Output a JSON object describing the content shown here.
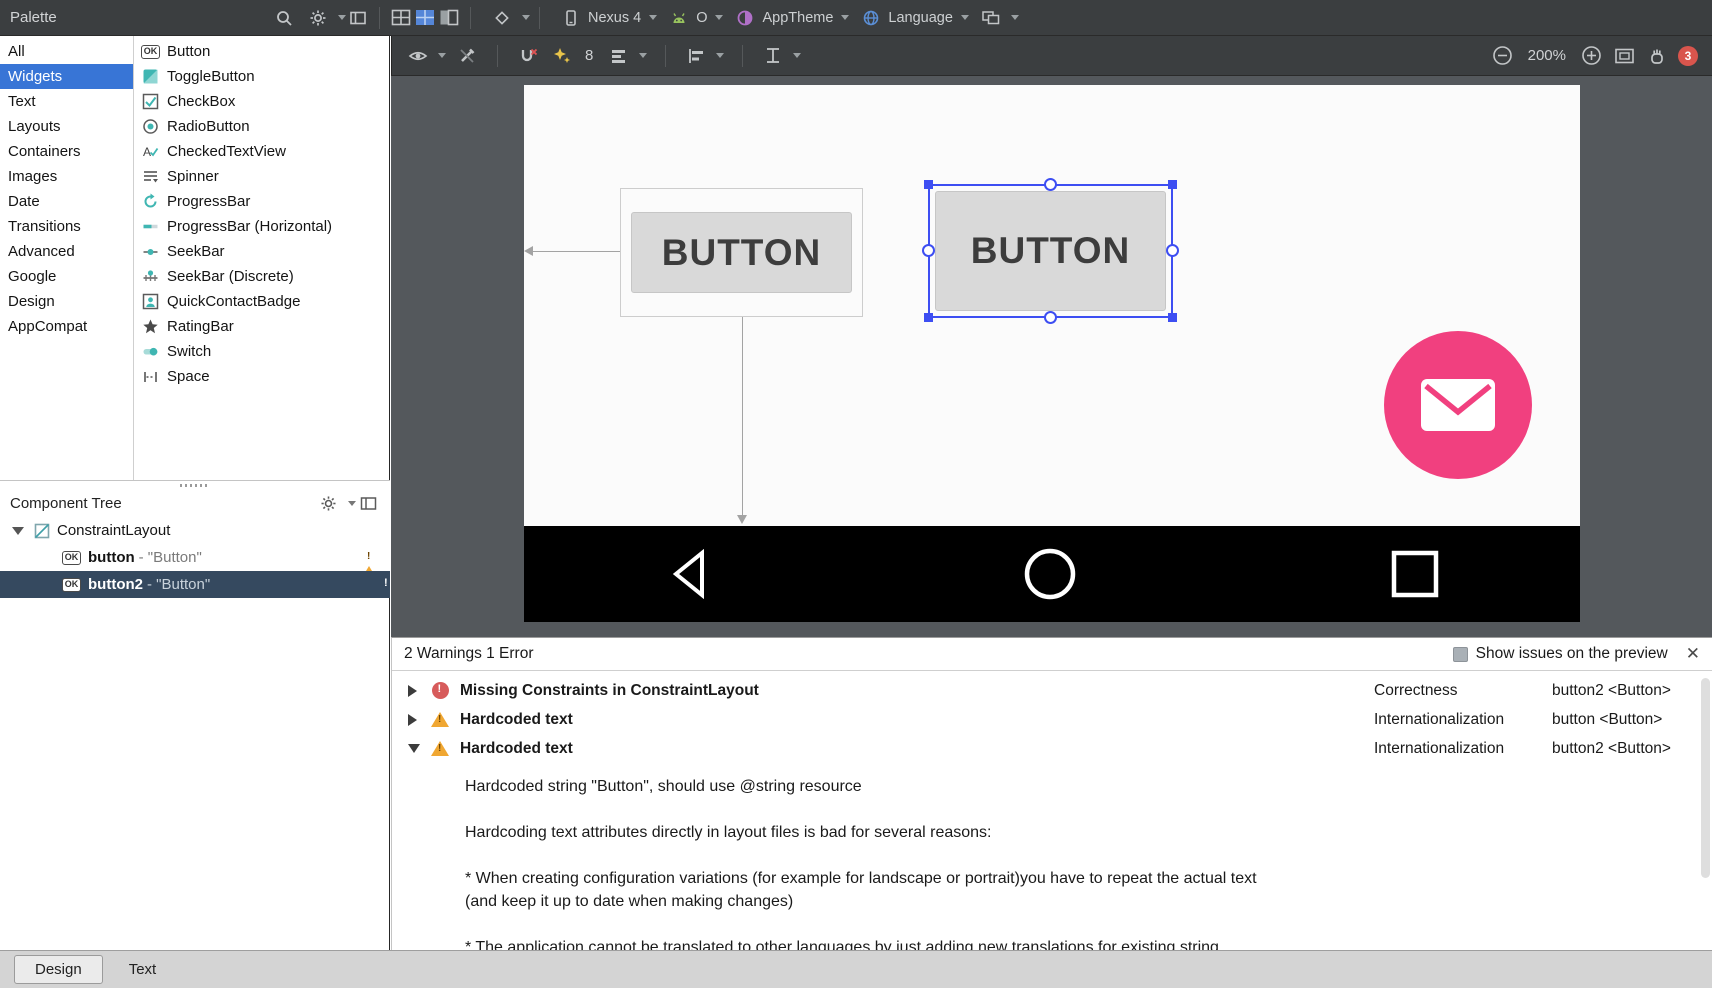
{
  "window": {
    "palette_title": "Palette",
    "component_tree_title": "Component Tree"
  },
  "toolbar": {
    "device_label": "Nexus 4",
    "api_label": "O",
    "theme_label": "AppTheme",
    "language_label": "Language"
  },
  "design_toolbar": {
    "default_margin": "8",
    "zoom_level": "200%",
    "issue_badge_count": "3"
  },
  "icons": {
    "ok_badge": "OK"
  },
  "palette": {
    "categories": [
      {
        "label": "All",
        "selected": false
      },
      {
        "label": "Widgets",
        "selected": true
      },
      {
        "label": "Text",
        "selected": false
      },
      {
        "label": "Layouts",
        "selected": false
      },
      {
        "label": "Containers",
        "selected": false
      },
      {
        "label": "Images",
        "selected": false
      },
      {
        "label": "Date",
        "selected": false
      },
      {
        "label": "Transitions",
        "selected": false
      },
      {
        "label": "Advanced",
        "selected": false
      },
      {
        "label": "Google",
        "selected": false
      },
      {
        "label": "Design",
        "selected": false
      },
      {
        "label": "AppCompat",
        "selected": false
      }
    ],
    "widgets": [
      {
        "label": "Button"
      },
      {
        "label": "ToggleButton"
      },
      {
        "label": "CheckBox"
      },
      {
        "label": "RadioButton"
      },
      {
        "label": "CheckedTextView"
      },
      {
        "label": "Spinner"
      },
      {
        "label": "ProgressBar"
      },
      {
        "label": "ProgressBar (Horizontal)"
      },
      {
        "label": "SeekBar"
      },
      {
        "label": "SeekBar (Discrete)"
      },
      {
        "label": "QuickContactBadge"
      },
      {
        "label": "RatingBar"
      },
      {
        "label": "Switch"
      },
      {
        "label": "Space"
      }
    ]
  },
  "component_tree": {
    "root_label": "ConstraintLayout",
    "items": [
      {
        "id": "button",
        "suffix": " - \"Button\"",
        "status": "warning"
      },
      {
        "id": "button2",
        "suffix": " - \"Button\"",
        "status": "error",
        "selected": true
      }
    ]
  },
  "canvas": {
    "button1_label": "BUTTON",
    "button2_label": "BUTTON"
  },
  "issues": {
    "header": "2 Warnings 1 Error",
    "show_on_preview_label": "Show issues on the preview",
    "close_glyph": "✕",
    "rows": [
      {
        "title": "Missing Constraints in ConstraintLayout",
        "severity": "error",
        "category": "Correctness",
        "location": "button2 <Button>",
        "expanded": false
      },
      {
        "title": "Hardcoded text",
        "severity": "warning",
        "category": "Internationalization",
        "location": "button <Button>",
        "expanded": false
      },
      {
        "title": "Hardcoded text",
        "severity": "warning",
        "category": "Internationalization",
        "location": "button2 <Button>",
        "expanded": true
      }
    ],
    "detail": {
      "line1": "Hardcoded string \"Button\", should use @string resource",
      "line2": "Hardcoding text attributes directly in layout files is bad for several reasons:",
      "line3": "* When creating configuration variations (for example for landscape or portrait)you have to repeat the actual text",
      "line4": "(and keep it up to date when making changes)",
      "line5": "* The application cannot be translated to other languages by just adding new translations for existing string"
    }
  },
  "bottom_tabs": [
    {
      "label": "Design",
      "selected": true
    },
    {
      "label": "Text",
      "selected": false
    }
  ],
  "colors": {
    "accent_blue": "#3875d6",
    "selection_blue": "#3d4ef2",
    "fab_pink": "#f1407f",
    "warning": "#f0a732",
    "error": "#d75b5b",
    "toolbar_bg": "#3b3e40",
    "canvas_bg": "#54585c"
  }
}
